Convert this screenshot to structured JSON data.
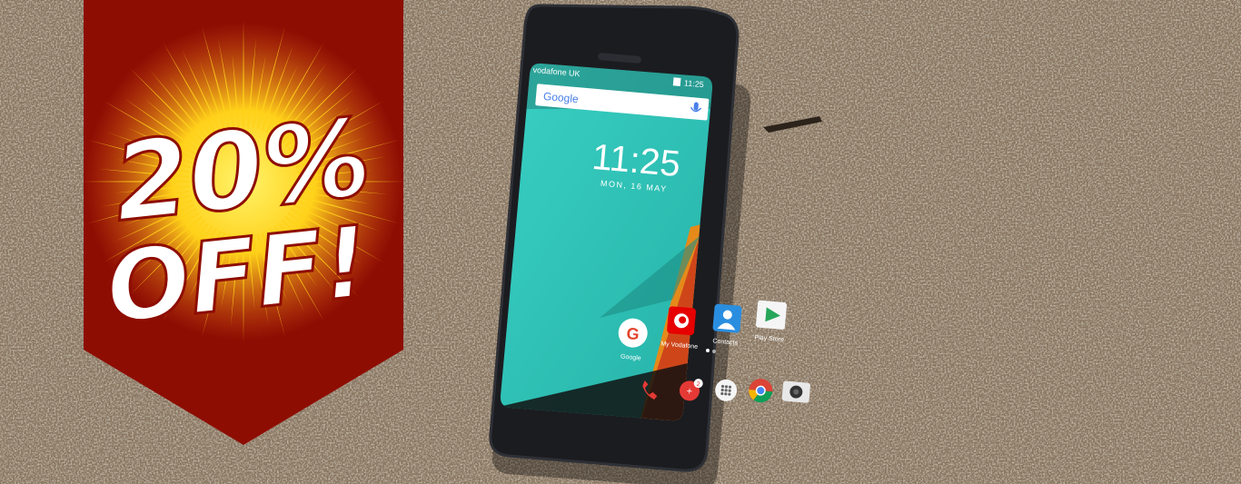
{
  "promo": {
    "percent": "20%",
    "off": "OFF!",
    "colors": {
      "banner": "#8e0d03",
      "burst_core": "#ffd11a",
      "burst_edge": "#e8721a",
      "text": "#ffffff"
    }
  },
  "phone": {
    "status": {
      "carrier": "vodafone UK",
      "time": "11:25"
    },
    "search": {
      "brand": "Google",
      "mic_icon": "mic-icon"
    },
    "clock": {
      "time": "11:25",
      "date": "MON, 16 MAY"
    },
    "apps": [
      {
        "label": "Google",
        "icon": "google-app-icon"
      },
      {
        "label": "My Vodafone",
        "icon": "vodafone-app-icon"
      },
      {
        "label": "Contacts",
        "icon": "contacts-app-icon"
      },
      {
        "label": "Play Store",
        "icon": "play-store-icon"
      }
    ],
    "dock": [
      {
        "icon": "phone-icon"
      },
      {
        "icon": "messages-icon",
        "badge": "2"
      },
      {
        "icon": "app-drawer-icon"
      },
      {
        "icon": "chrome-icon"
      },
      {
        "icon": "camera-icon"
      }
    ],
    "colors": {
      "wallpaper": "#2fc3b8",
      "accent_orange": "#e58a1a",
      "body": "#1b1c20"
    }
  },
  "background": {
    "colors": {
      "gravel": "#8a7660"
    }
  }
}
